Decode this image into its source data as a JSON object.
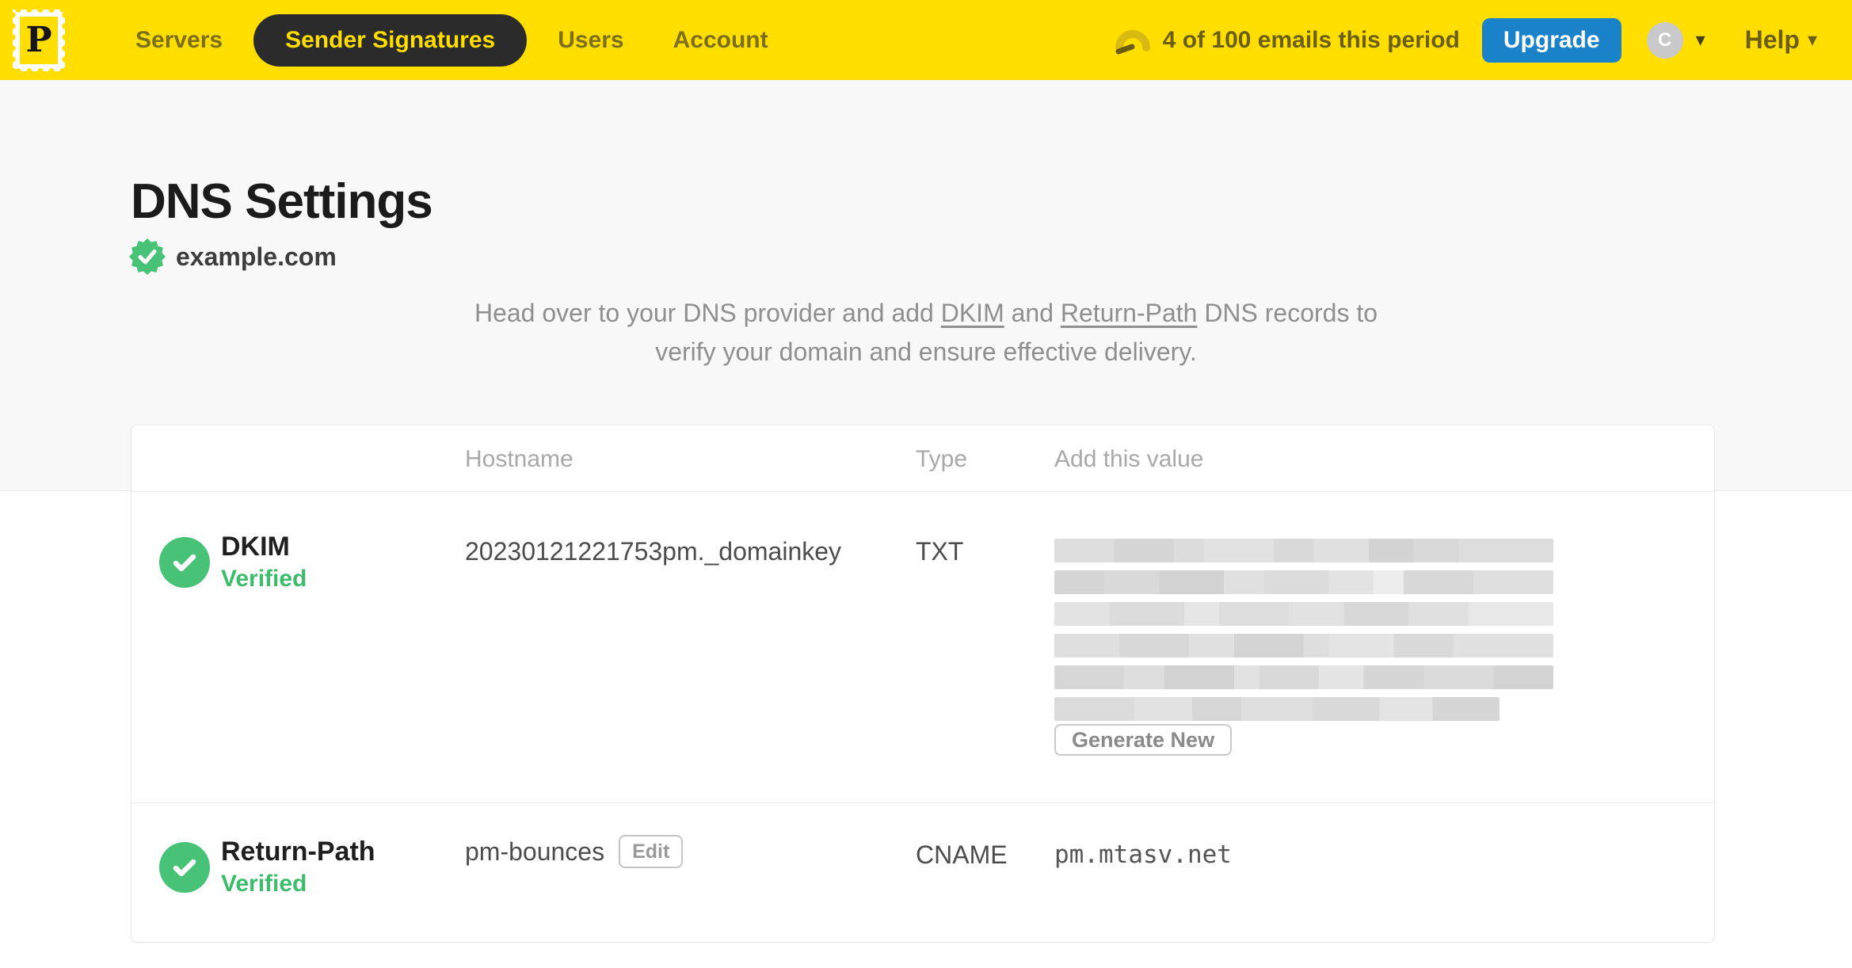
{
  "colors": {
    "brand_yellow": "#FFDE00",
    "nav_pill_dark": "#2B2B2B",
    "upgrade_blue": "#1A82C8",
    "verified_green": "#47C277",
    "top_section_bg": "#F8F8F8"
  },
  "navbar": {
    "logo_letter": "P",
    "items": [
      {
        "label": "Servers",
        "active": false
      },
      {
        "label": "Sender Signatures",
        "active": true
      },
      {
        "label": "Users",
        "active": false
      },
      {
        "label": "Account",
        "active": false
      }
    ],
    "usage_text": "4 of 100 emails this period",
    "upgrade_label": "Upgrade",
    "avatar_initial": "C",
    "help_label": "Help"
  },
  "page": {
    "title": "DNS Settings",
    "domain": "example.com",
    "domain_verified": true,
    "description": {
      "pre": "Head over to your DNS provider and add ",
      "dkim_link": "DKIM",
      "mid": " and ",
      "return_path_link": "Return-Path",
      "post": " DNS records to",
      "line2": "verify your domain and ensure effective delivery."
    }
  },
  "table": {
    "headers": {
      "hostname": "Hostname",
      "type": "Type",
      "value": "Add this value"
    },
    "rows": [
      {
        "name": "DKIM",
        "status": "Verified",
        "hostname": "20230121221753pm._domainkey",
        "type": "TXT",
        "value_redacted": true,
        "action_label": "Generate New"
      },
      {
        "name": "Return-Path",
        "status": "Verified",
        "hostname": "pm-bounces",
        "edit_label": "Edit",
        "type": "CNAME",
        "value": "pm.mtasv.net"
      }
    ]
  }
}
